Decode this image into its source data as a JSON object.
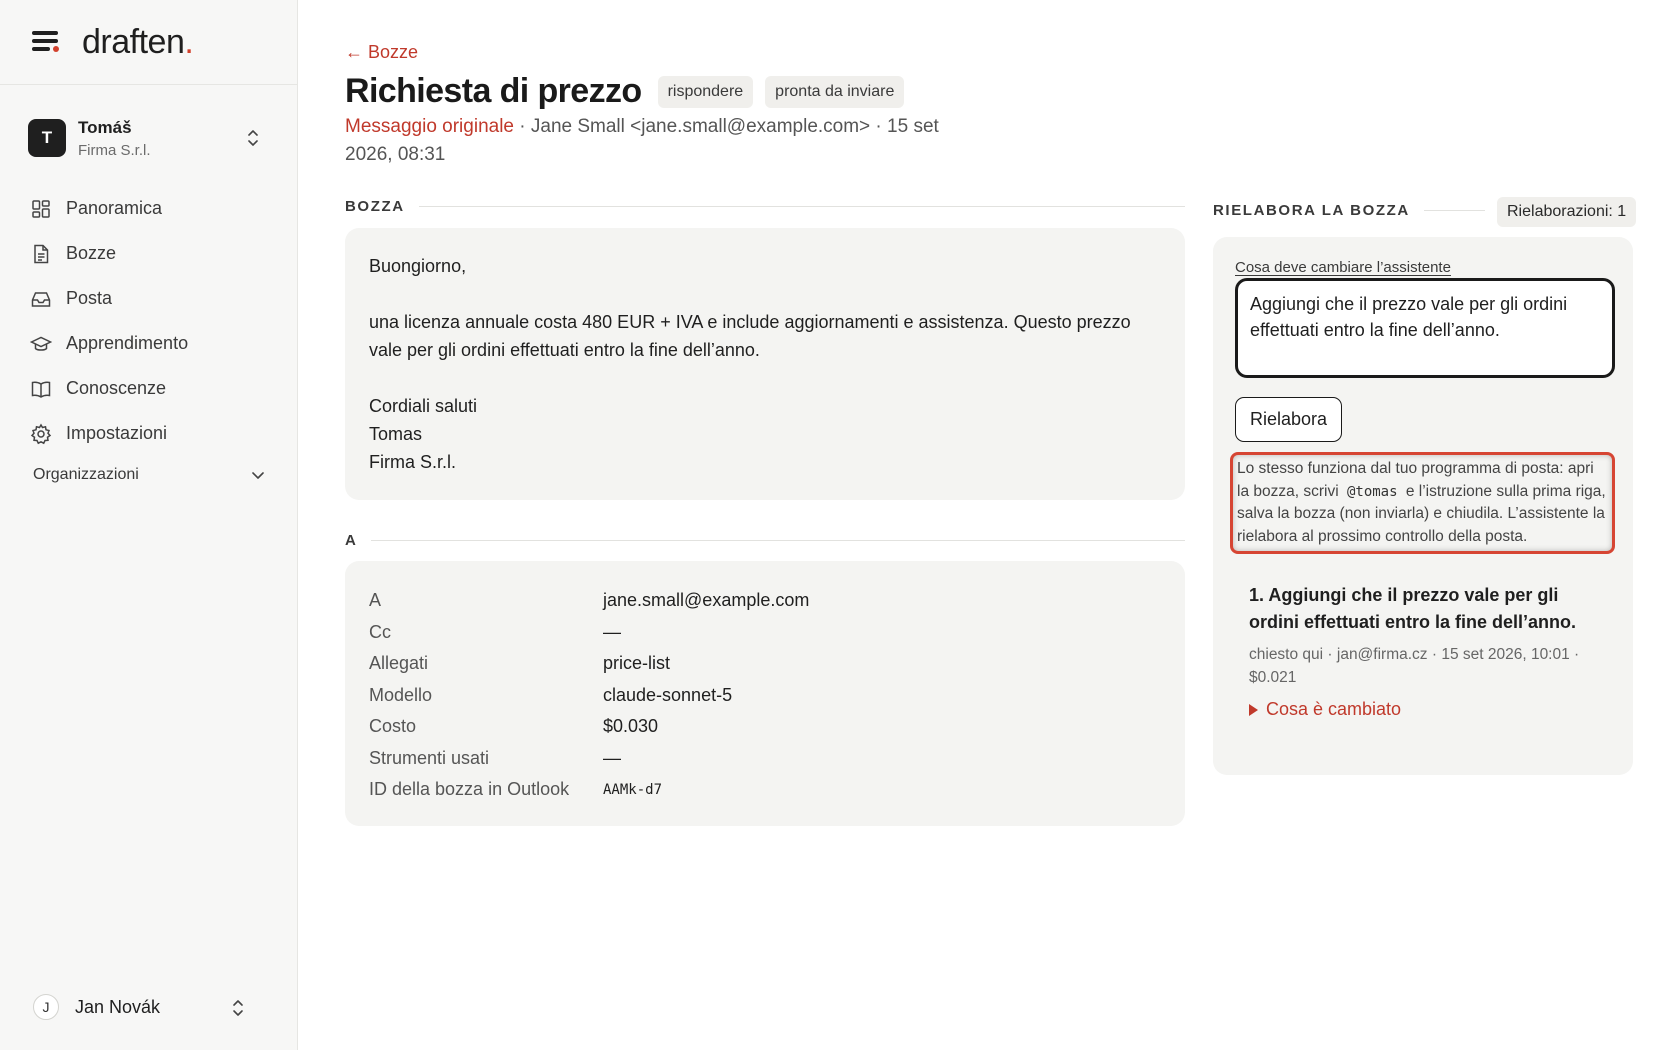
{
  "app": {
    "brand_name": "draften",
    "brand_dot": ".",
    "accent_color": "#c0392b"
  },
  "org": {
    "initial": "T",
    "name": "Tomáš",
    "subtitle": "Firma S.r.l."
  },
  "nav": {
    "items": [
      {
        "label": "Panoramica",
        "icon": "grid-icon"
      },
      {
        "label": "Bozze",
        "icon": "document-icon"
      },
      {
        "label": "Posta",
        "icon": "inbox-icon"
      },
      {
        "label": "Apprendimento",
        "icon": "graduation-cap-icon"
      },
      {
        "label": "Conoscenze",
        "icon": "book-icon"
      },
      {
        "label": "Impostazioni",
        "icon": "gear-icon"
      }
    ],
    "section_label": "Organizzazioni"
  },
  "user": {
    "initial": "J",
    "name": "Jan Novák"
  },
  "header": {
    "back_label": "← Bozze",
    "title": "Richiesta di prezzo",
    "tags": [
      "rispondere",
      "pronta da inviare"
    ],
    "original_link": "Messaggio originale",
    "meta": " · Jane Small <jane.small@example.com> · 15 set 2026, 08:31"
  },
  "draft": {
    "section_label": "BOZZA",
    "greeting": "Buongiorno,",
    "body": "una licenza annuale costa 480 EUR + IVA e include aggiornamenti e assistenza. Questo prezzo vale per gli ordini effettuati entro la fine dell’anno.",
    "closing": "Cordiali saluti",
    "signature_name": "Tomas",
    "signature_company": "Firma S.r.l."
  },
  "details": {
    "section_label": "A",
    "rows": [
      {
        "key": "A",
        "value": "jane.small@example.com"
      },
      {
        "key": "Cc",
        "value": "—"
      },
      {
        "key": "Allegati",
        "value": "price-list"
      },
      {
        "key": "Modello",
        "value": "claude-sonnet-5"
      },
      {
        "key": "Costo",
        "value": "$0.030"
      },
      {
        "key": "Strumenti usati",
        "value": "—"
      },
      {
        "key": "ID della bozza in Outlook",
        "value": "AAMk-d7"
      }
    ]
  },
  "rework": {
    "section_label": "RIELABORA LA BOZZA",
    "count_label": "Rielaborazioni: 1",
    "field_label": "Cosa deve cambiare l’assistente",
    "field_value": "Aggiungi che il prezzo vale per gli ordini effettuati entro la fine dell’anno.",
    "button_label": "Rielabora",
    "hint_part1": "Lo stesso funziona dal tuo programma di posta: apri la bozza, scrivi",
    "hint_code": "@tomas",
    "hint_part2": "e l’istruzione sulla prima riga, salva la bozza (non inviarla) e chiudila. L’assistente la rielabora al prossimo controllo della posta.",
    "history": [
      {
        "title": "1. Aggiungi che il prezzo vale per gli ordini effettuati entro la fine dell’anno.",
        "meta": "chiesto qui · jan@firma.cz · 15 set 2026, 10:01 · $0.021",
        "toggle": "Cosa è cambiato"
      }
    ]
  }
}
